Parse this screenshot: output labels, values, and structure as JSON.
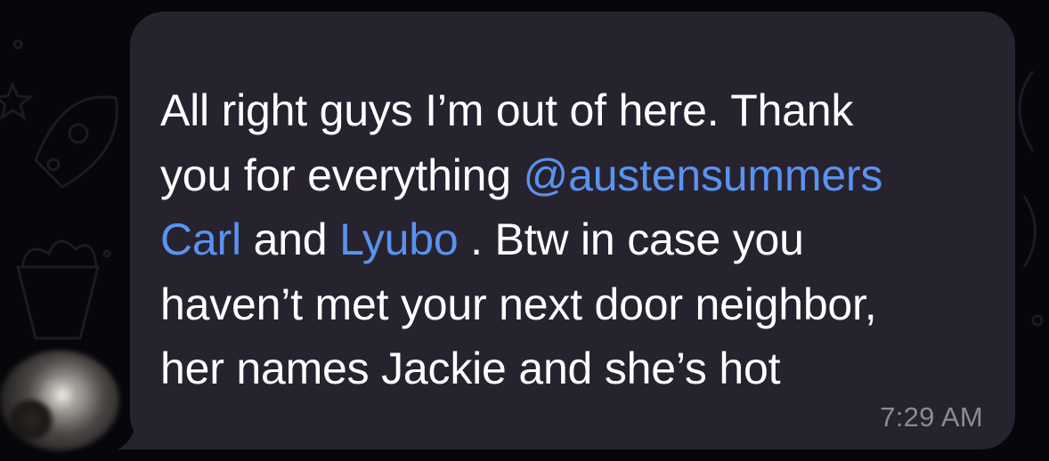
{
  "message": {
    "line1": "All right guys I’m out of here. Thank",
    "line2_before": "you for everything ",
    "mention_austen": "@austensummers",
    "mention_carl": "Carl",
    "line3_and": " and ",
    "mention_lyubo": "Lyubo",
    "line3_after": " . Btw in case you",
    "line4": "haven’t met your next door neighbor,",
    "line5": "her names Jackie and she’s hot",
    "time": "7:29 AM"
  },
  "colors": {
    "background": "#07060b",
    "bubble": "#27232e",
    "text": "#ffffff",
    "mention": "#5a92f0",
    "timestamp": "#8c8a93"
  },
  "icons": {
    "background_doodles": [
      "star-icon",
      "rocket-icon",
      "popcorn-icon",
      "sparkle-icon"
    ]
  }
}
